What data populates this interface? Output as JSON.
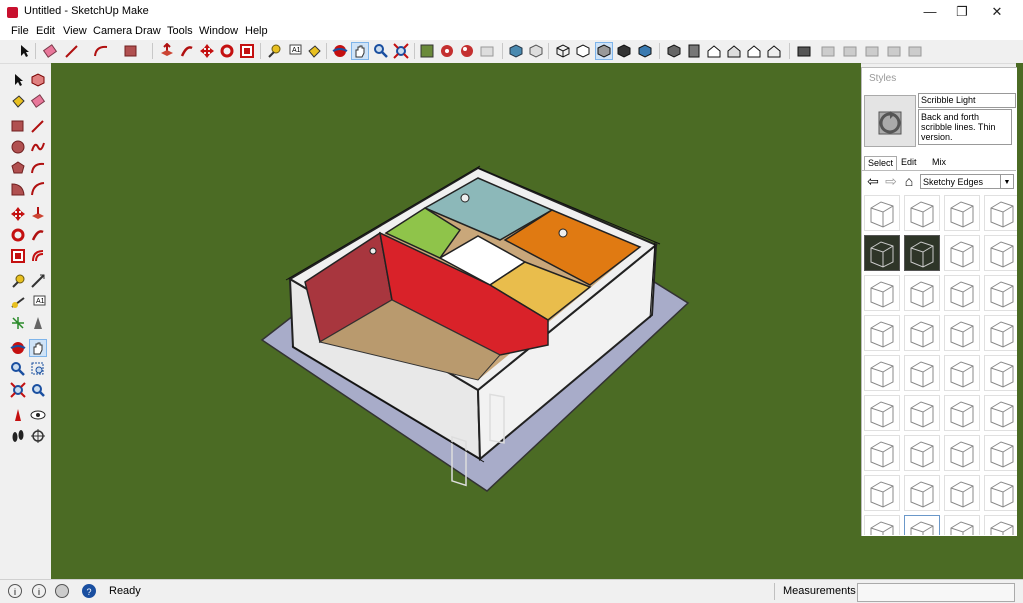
{
  "window": {
    "title": "Untitled - SketchUp Make",
    "minimize": "—",
    "maximize": "❐",
    "close": "✕"
  },
  "menu": [
    "File",
    "Edit",
    "View",
    "Camera",
    "Draw",
    "Tools",
    "Window",
    "Help"
  ],
  "styles_panel": {
    "title": "Styles",
    "style_name": "Scribble Light",
    "style_description": "Back and forth scribble lines.  Thin version.",
    "tabs": [
      "Select",
      "Edit",
      "Mix"
    ],
    "active_tab": "Select",
    "collection": "Sketchy Edges"
  },
  "status": {
    "text": "Ready",
    "measurements_label": "Measurements",
    "measurements_value": ""
  },
  "colors": {
    "viewport_bg": "#4b6b24",
    "wall_red": "#d92229",
    "wall_green": "#8fc44a",
    "wall_teal": "#8cb8b9",
    "wall_orange": "#e07a12",
    "wall_yellow": "#e9bd4c",
    "wall_maroon": "#a8363e",
    "floor": "#b99a6e",
    "ground_plane": "#a8acc9"
  }
}
